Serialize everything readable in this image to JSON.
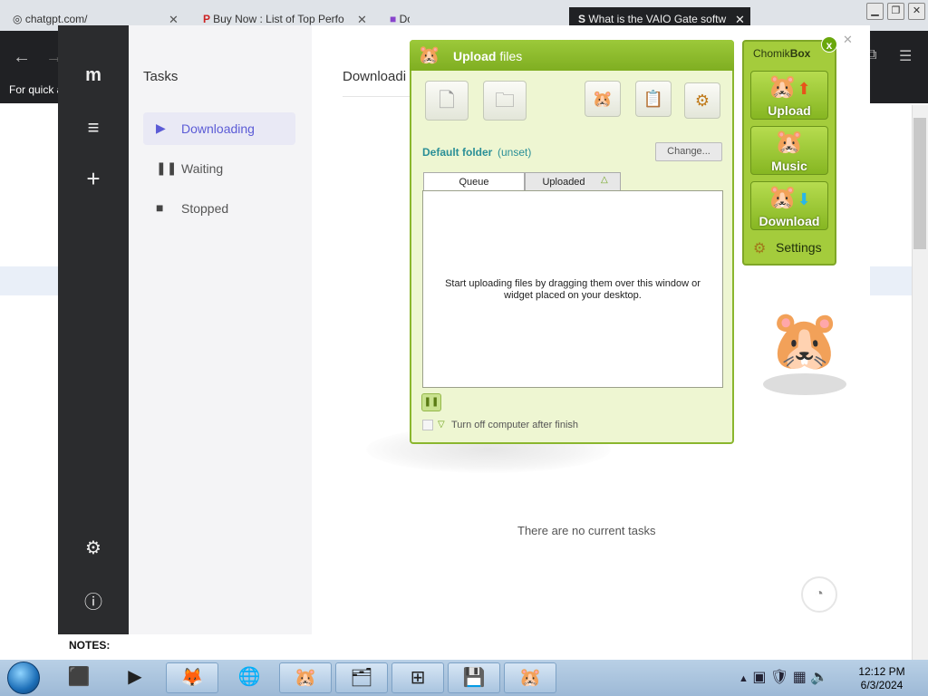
{
  "browser": {
    "tabs": [
      {
        "label": "chatgpt.com/",
        "icon": "chatgpt-icon",
        "active": false
      },
      {
        "label": "Buy Now : List of Top Perfo",
        "icon": "p-icon",
        "active": false
      },
      {
        "label": "Do",
        "icon": "document-icon",
        "active": false
      },
      {
        "label": "What is the VAIO Gate softw",
        "icon": "s-icon",
        "active": true
      }
    ],
    "quick_text": "For quick a"
  },
  "motrix": {
    "tasks_title": "Tasks",
    "nav": [
      {
        "label": "Downloading",
        "icon": "play-icon",
        "selected": true
      },
      {
        "label": "Waiting",
        "icon": "pause-icon",
        "selected": false
      },
      {
        "label": "Stopped",
        "icon": "stop-icon",
        "selected": false
      }
    ],
    "main_title": "Downloadi",
    "empty_text": "There are no current tasks"
  },
  "upload": {
    "title_bold": "Upload",
    "title_rest": "files",
    "default_folder_label": "Default folder",
    "default_folder_value": "(unset)",
    "change_button": "Change...",
    "tab_queue": "Queue",
    "tab_uploaded": "Uploaded",
    "queue_message": "Start uploading files by dragging them over this window or widget placed on your desktop.",
    "shutdown_label": "Turn off computer after finish"
  },
  "widget": {
    "title_plain": "Chomik",
    "title_bold": "Box",
    "upload_label": "Upload",
    "music_label": "Music",
    "download_label": "Download",
    "settings_label": "Settings",
    "accent": "#a4cc3c"
  },
  "page": {
    "notes_label": "NOTES:"
  },
  "taskbar": {
    "time": "12:12 PM",
    "date": "6/3/2024"
  }
}
